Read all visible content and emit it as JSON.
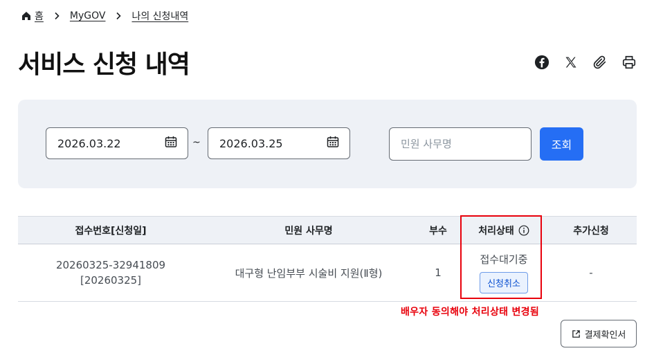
{
  "breadcrumb": {
    "home": "홈",
    "items": [
      "MyGOV",
      "나의 신청내역"
    ]
  },
  "page_title": "서비스 신청 내역",
  "share_icons": [
    "facebook-icon",
    "x-icon",
    "paperclip-icon",
    "printer-icon"
  ],
  "filter": {
    "start_date": "2026.03.22",
    "separator": "~",
    "end_date": "2026.03.25",
    "search_placeholder": "민원 사무명",
    "search_button": "조회"
  },
  "table": {
    "headers": {
      "receipt": "접수번호[신청일]",
      "name": "민원 사무명",
      "count": "부수",
      "status": "처리상태",
      "extra": "추가신청"
    },
    "rows": [
      {
        "receipt_no": "20260325-32941809",
        "applied_date": "[20260325]",
        "name": "대구형 난임부부 시술비 지원(Ⅱ형)",
        "count": "1",
        "status": "접수대기중",
        "cancel_button": "신청취소",
        "extra": "-"
      }
    ]
  },
  "annotation": "배우자 동의해야 처리상태 변경됨",
  "receipt_button": "결제확인서",
  "colors": {
    "primary": "#256ef4",
    "highlight": "#e8000b",
    "filter_bg": "#eef1f6"
  }
}
